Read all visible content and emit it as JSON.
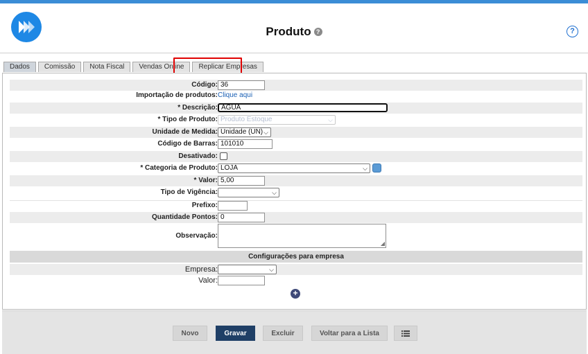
{
  "header": {
    "title": "Produto",
    "help_glyph": "?",
    "title_info_glyph": "?",
    "logo_icon": "logo-icon"
  },
  "tabs": [
    {
      "label": "Dados",
      "active": true
    },
    {
      "label": "Comissão",
      "active": false
    },
    {
      "label": "Nota Fiscal",
      "active": false
    },
    {
      "label": "Vendas Online",
      "active": false
    },
    {
      "label": "Replicar Empresas",
      "active": false
    }
  ],
  "form": {
    "codigo": {
      "label": "Código:",
      "value": "36"
    },
    "importacao": {
      "label": "Importação de produtos:",
      "link": "Clique aqui"
    },
    "descricao": {
      "label": "* Descrição:",
      "value": "AGUA"
    },
    "tipo_produto": {
      "label": "* Tipo de Produto:",
      "value": "Produto Estoque"
    },
    "unidade_medida": {
      "label": "Unidade de Medida:",
      "value": "Unidade (UN)"
    },
    "codigo_barras": {
      "label": "Código de Barras:",
      "value": "101010"
    },
    "desativado": {
      "label": "Desativado:",
      "checked": false
    },
    "categoria": {
      "label": "* Categoria de Produto:",
      "value": "LOJA"
    },
    "valor": {
      "label": "* Valor:",
      "value": "5,00"
    },
    "tipo_vigencia": {
      "label": "Tipo de Vigência:",
      "value": ""
    },
    "prefixo": {
      "label": "Prefixo:",
      "value": ""
    },
    "quantidade_pontos": {
      "label": "Quantidade Pontos:",
      "value": "0"
    },
    "observacao": {
      "label": "Observação:",
      "value": ""
    }
  },
  "empresa_section": {
    "title": "Configurações para empresa",
    "empresa": {
      "label": "Empresa:",
      "value": ""
    },
    "valor": {
      "label": "Valor:",
      "value": ""
    },
    "add_glyph": "+"
  },
  "footer": {
    "novo": "Novo",
    "gravar": "Gravar",
    "excluir": "Excluir",
    "voltar": "Voltar para a Lista"
  },
  "colors": {
    "accent": "#1e88e5",
    "primary_button": "#1f3f66",
    "highlight": "#e00000"
  }
}
